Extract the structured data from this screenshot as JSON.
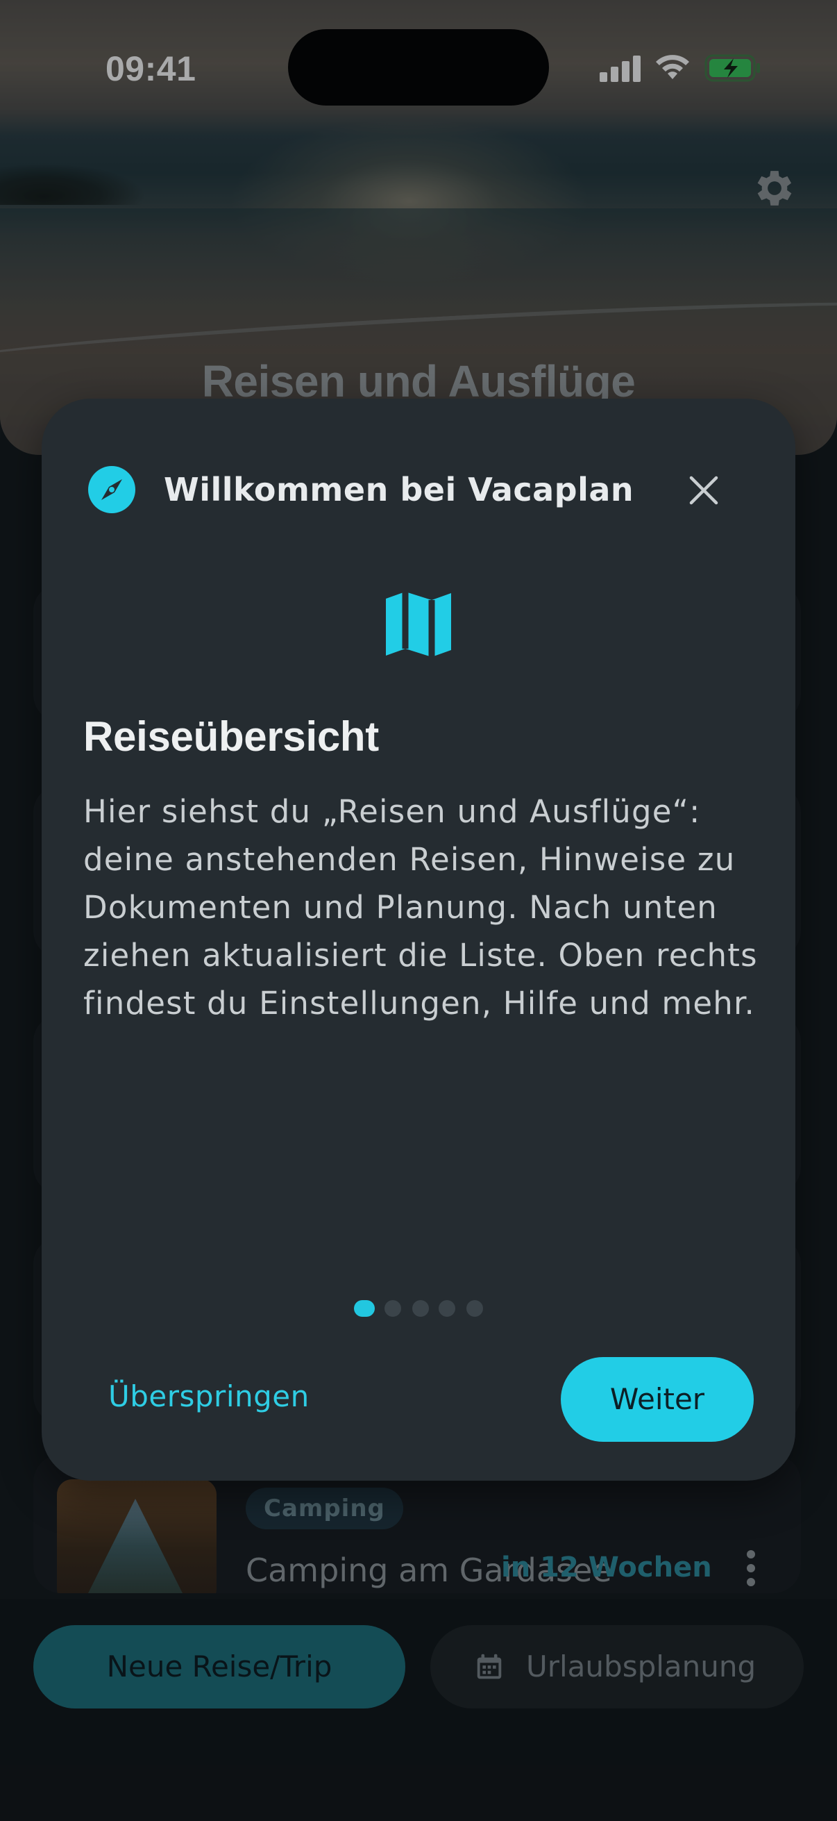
{
  "status_bar": {
    "time": "09:41"
  },
  "hero": {
    "title": "Reisen und Ausflüge"
  },
  "trip": {
    "badge": "Camping",
    "title": "Camping am Gardasee",
    "when": "in 12 Wochen"
  },
  "bottom_bar": {
    "new_trip_label": "Neue Reise/Trip",
    "planning_label": "Urlaubsplanung"
  },
  "modal": {
    "header": "Willkommen bei Vacaplan",
    "title": "Reiseübersicht",
    "body": "Hier siehst du „Reisen und Ausflüge“: deine anstehenden Reisen, Hinweise zu Dokumenten und Planung. Nach unten ziehen aktualisiert die Liste. Oben rechts findest du Einstellungen, Hilfe und mehr.",
    "skip_label": "Überspringen",
    "next_label": "Weiter",
    "page_count": 5,
    "active_page": 1
  },
  "colors": {
    "accent": "#22CDE6",
    "modal_background": "#252C31",
    "page_background": "#12171B"
  },
  "icons": [
    "signal-icon",
    "wifi-icon",
    "battery-charging-icon",
    "gear-icon",
    "compass-icon",
    "close-icon",
    "map-icon",
    "more-vertical-icon",
    "calendar-icon"
  ]
}
